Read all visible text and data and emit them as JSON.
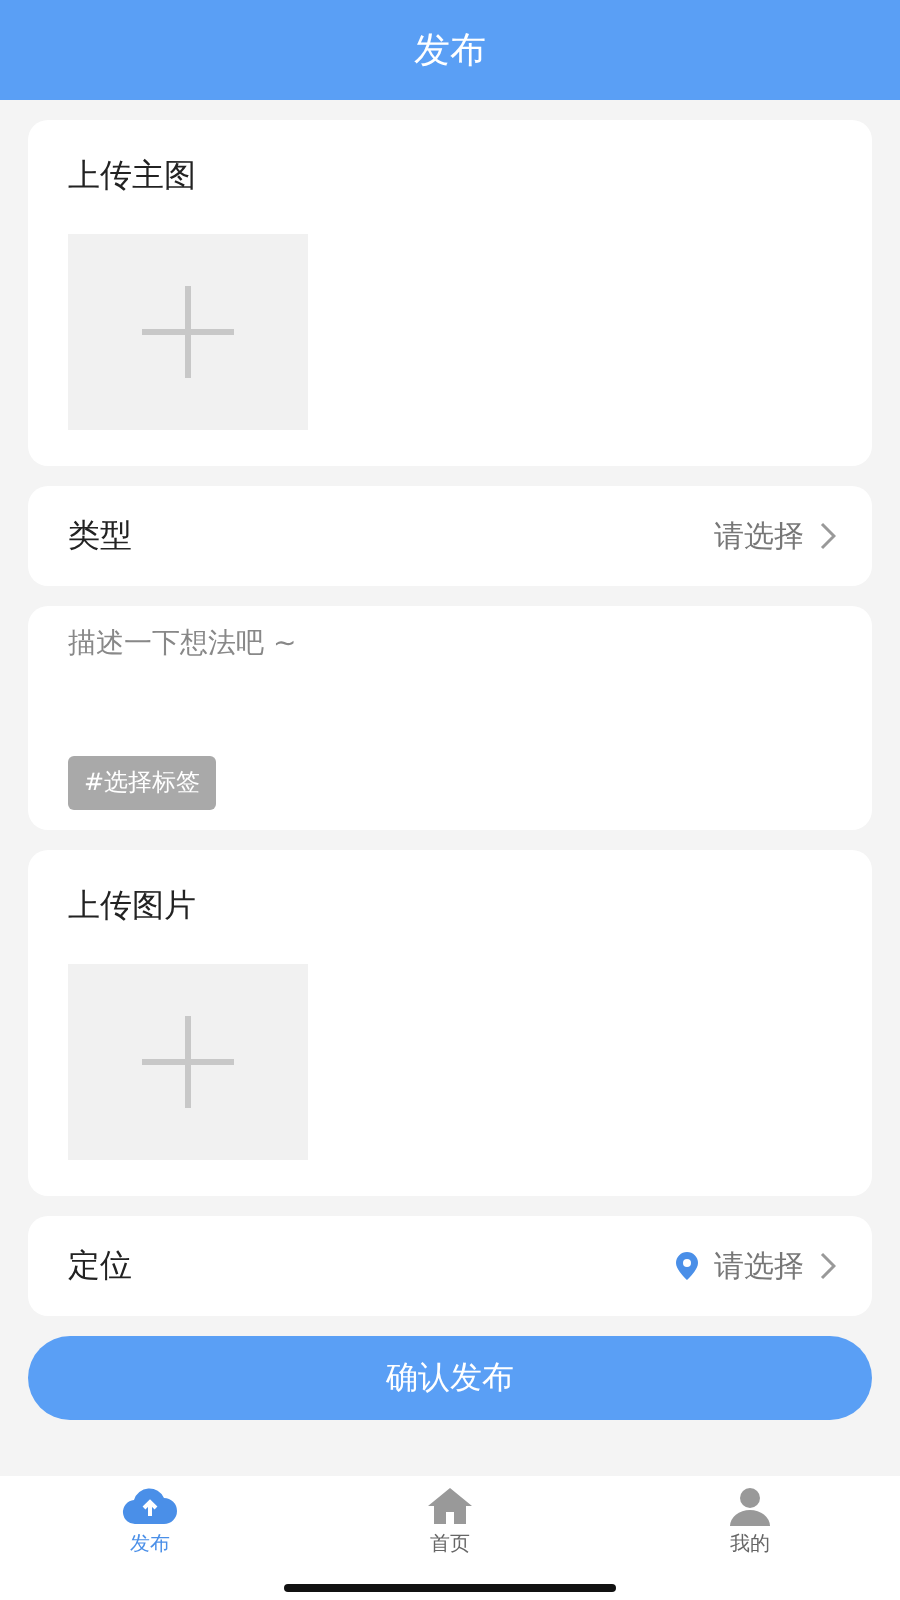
{
  "header": {
    "title": "发布"
  },
  "main_image": {
    "label": "上传主图"
  },
  "type_row": {
    "label": "类型",
    "value": "请选择"
  },
  "description": {
    "placeholder": "描述一下想法吧 ~",
    "tag": "#选择标签"
  },
  "images": {
    "label": "上传图片"
  },
  "location_row": {
    "label": "定位",
    "value": "请选择"
  },
  "submit": "确认发布",
  "tabs": [
    {
      "label": "发布",
      "kind": "upload",
      "selected": true
    },
    {
      "label": "首页",
      "kind": "home",
      "selected": false
    },
    {
      "label": "我的",
      "kind": "profile",
      "selected": false
    }
  ]
}
